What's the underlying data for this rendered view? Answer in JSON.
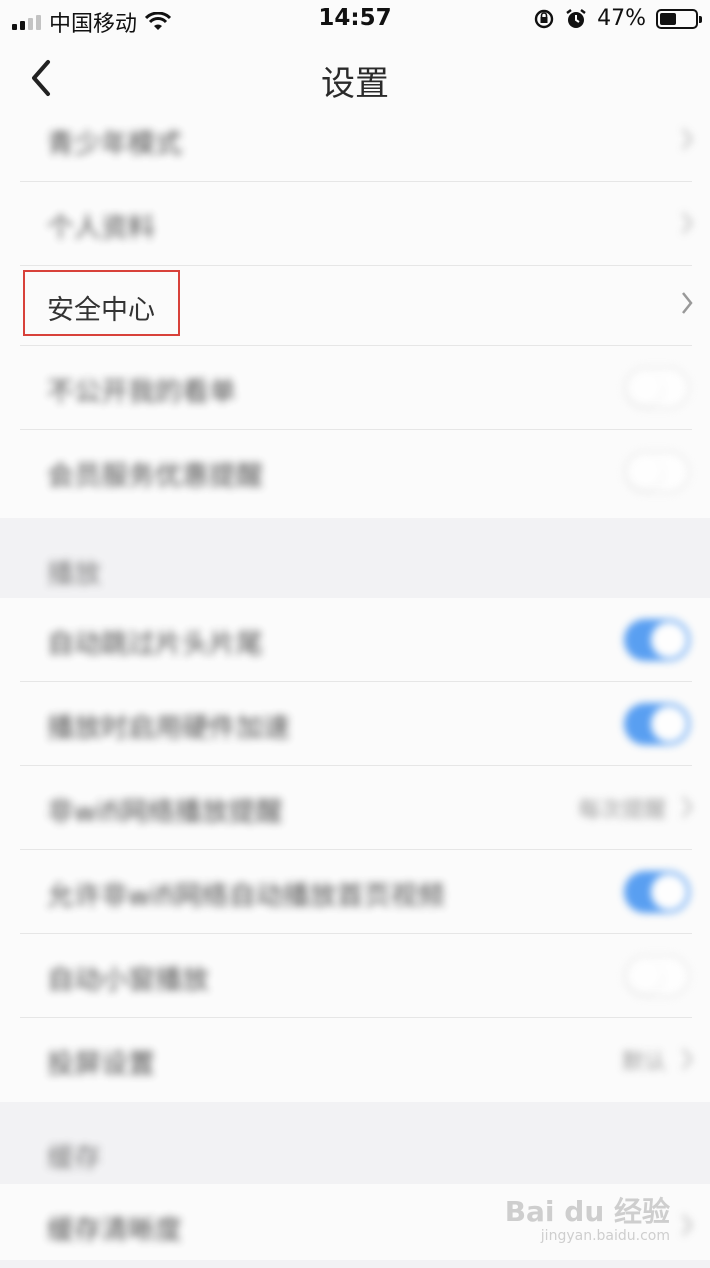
{
  "status_bar": {
    "carrier": "中国移动",
    "time": "14:57",
    "battery_percent": "47%",
    "battery_level": 0.47,
    "icons": [
      "signal-icon",
      "wifi-icon",
      "orientation-lock-icon",
      "alarm-icon",
      "battery-icon"
    ]
  },
  "nav": {
    "title": "设置",
    "back_icon": "chevron-left-icon"
  },
  "section1": {
    "rows": [
      {
        "label": "青少年模式",
        "control": "chevron"
      },
      {
        "label": "个人资料",
        "control": "chevron"
      },
      {
        "label": "安全中心",
        "control": "chevron",
        "highlighted": true
      },
      {
        "label": "不公开我的看单",
        "control": "toggle",
        "on": false
      },
      {
        "label": "会员服务优惠提醒",
        "control": "toggle",
        "on": false
      }
    ]
  },
  "play_header": {
    "label": "播放"
  },
  "section2": {
    "rows": [
      {
        "label": "自动跳过片头片尾",
        "control": "toggle",
        "on": true
      },
      {
        "label": "播放时启用硬件加速",
        "control": "toggle",
        "on": true
      },
      {
        "label": "非wifi网络播放提醒",
        "control": "chevron",
        "value": "每次提醒"
      },
      {
        "label": "允许非wifi网络自动播放首页视频",
        "control": "toggle",
        "on": true
      },
      {
        "label": "自动小窗播放",
        "control": "toggle",
        "on": false
      },
      {
        "label": "投屏设置",
        "control": "chevron",
        "value": "默认"
      }
    ]
  },
  "cache_header": {
    "label": "缓存"
  },
  "section3": {
    "rows": [
      {
        "label": "缓存清晰度",
        "control": "chevron"
      }
    ]
  },
  "watermark": {
    "text": "Bai du 经验",
    "sub": "jingyan.baidu.com"
  },
  "colors": {
    "accent": "#3d8ff0",
    "highlight_border": "#d8413a"
  }
}
